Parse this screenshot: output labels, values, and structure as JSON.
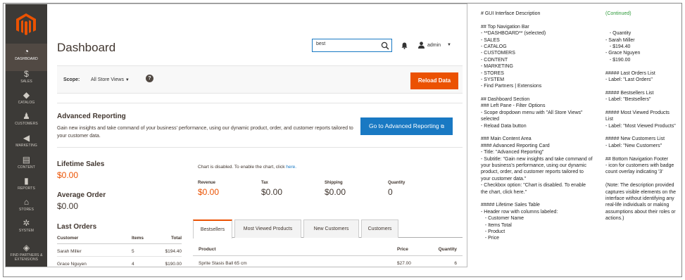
{
  "sidebar": {
    "items": [
      {
        "label": "DASHBOARD",
        "icon": "dashboard-gauge-icon",
        "glyph": "◔"
      },
      {
        "label": "SALES",
        "icon": "dollar-icon",
        "glyph": "$"
      },
      {
        "label": "CATALOG",
        "icon": "cube-icon",
        "glyph": "◆"
      },
      {
        "label": "CUSTOMERS",
        "icon": "person-icon",
        "glyph": "♟"
      },
      {
        "label": "MARKETING",
        "icon": "megaphone-icon",
        "glyph": "◀"
      },
      {
        "label": "CONTENT",
        "icon": "layout-icon",
        "glyph": "▤"
      },
      {
        "label": "REPORTS",
        "icon": "bar-chart-icon",
        "glyph": "▮"
      },
      {
        "label": "STORES",
        "icon": "storefront-icon",
        "glyph": "⌂"
      },
      {
        "label": "SYSTEM",
        "icon": "gear-icon",
        "glyph": "✲"
      },
      {
        "label": "FIND PARTNERS & EXTENSIONS",
        "icon": "box-icon",
        "glyph": "◈"
      }
    ]
  },
  "header": {
    "title": "Dashboard",
    "search_value": "best",
    "user": "admin"
  },
  "scope": {
    "label": "Scope:",
    "value": "All Store Views",
    "reload_label": "Reload Data"
  },
  "advanced": {
    "title": "Advanced Reporting",
    "subtitle": "Gain new insights and take command of your business' performance, using our dynamic product, order, and customer reports tailored to your customer data.",
    "button_label": "Go to Advanced Reporting"
  },
  "stats": {
    "lifetime_title": "Lifetime Sales",
    "lifetime_value": "$0.00",
    "avg_title": "Average Order",
    "avg_value": "$0.00",
    "chart_note": "Chart is disabled. To enable the chart, click ",
    "chart_link": "here."
  },
  "totals": [
    {
      "label": "Revenue",
      "value": "$0.00"
    },
    {
      "label": "Tax",
      "value": "$0.00"
    },
    {
      "label": "Shipping",
      "value": "$0.00"
    },
    {
      "label": "Quantity",
      "value": "0"
    }
  ],
  "last_orders": {
    "title": "Last Orders",
    "headers": [
      "Customer",
      "Items",
      "Total"
    ],
    "rows": [
      [
        "Sarah Miller",
        "5",
        "$194.40"
      ],
      [
        "Grace Nguyen",
        "4",
        "$190.00"
      ]
    ]
  },
  "tabs": [
    "Bestsellers",
    "Most Viewed Products",
    "New Customers",
    "Customers"
  ],
  "products": {
    "headers": [
      "Product",
      "Price",
      "Quantity"
    ],
    "rows": [
      [
        "Sprite Stasis Ball 65 cm",
        "$27.00",
        "6"
      ]
    ]
  },
  "description": {
    "col1": [
      "# GUI Interface Description",
      "",
      "## Top Navigation Bar",
      "- **DASHBOARD** (selected)",
      "- SALES",
      "- CATALOG",
      "- CUSTOMERS",
      "- CONTENT",
      "- MARKETING",
      "- STORES",
      "- SYSTEM",
      "- Find Partners | Extensions",
      "",
      "## Dashboard Section",
      "### Left Pane - Filter Options",
      "- Scope dropdown menu with \"All Store Views\"",
      "selected",
      "- Reload Data button",
      "",
      "### Main Content Area",
      "#### Advanced Reporting Card",
      "- Title: \"Advanced Reporting\"",
      "- Subtitle: \"Gain new insights and take command of",
      "your business's performance, using our dynamic",
      "product, order, and customer reports tailored to",
      "your customer data.\"",
      "- Checkbox option: \"Chart is disabled. To enable",
      "the chart, click here.\"",
      "",
      "##### Lifetime Sales Table",
      "- Header row with columns labeled:",
      "   - Customer Name",
      "   - Items Total",
      "   - Product",
      "   - Price"
    ],
    "col2": [
      "(Continued)",
      "",
      "",
      "   - Quantity",
      "- Sarah Miller",
      "   - $194.40",
      "- Grace Nguyen",
      "   - $190.00",
      "",
      "##### Last Orders List",
      "- Label: \"Last Orders\"",
      "",
      "##### Bestsellers List",
      "- Label: \"Bestsellers\"",
      "",
      "##### Most Viewed Products",
      "List",
      "- Label: \"Most Viewed Products\"",
      "",
      "##### New Customers List",
      "- Label: \"New Customers\"",
      "",
      "## Bottom Navigation Footer",
      "- icon for customers with badge",
      "count overlay indicating '3'",
      "",
      "(Note: The description provided",
      "captures visible elements on the",
      "interface without identifying any",
      "real-life individuals or making",
      "assumptions about their roles or",
      "actions.)"
    ]
  },
  "colors": {
    "sidebar_bg": "#3c3a37",
    "accent_orange": "#eb5202",
    "accent_blue": "#1979c3",
    "continued_green": "#2e9a3a"
  }
}
